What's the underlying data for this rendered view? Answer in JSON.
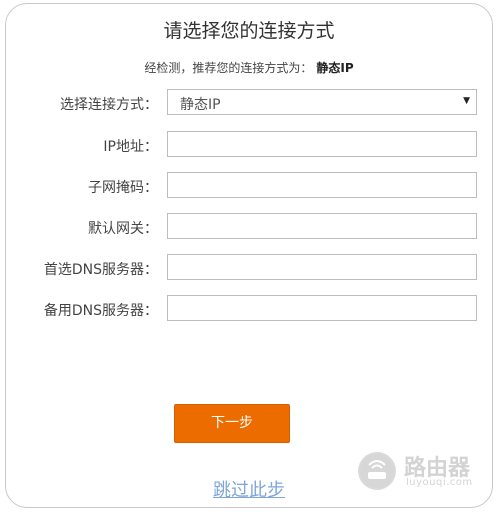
{
  "dialog": {
    "title": "请选择您的连接方式",
    "detect_prefix": "经检测，推荐您的连接方式为：",
    "detect_value": "静态IP"
  },
  "form": {
    "connection_type": {
      "label": "选择连接方式：",
      "selected": "静态IP"
    },
    "ip_address": {
      "label": "IP地址：",
      "value": ""
    },
    "subnet_mask": {
      "label": "子网掩码：",
      "value": ""
    },
    "default_gateway": {
      "label": "默认网关：",
      "value": ""
    },
    "primary_dns": {
      "label": "首选DNS服务器：",
      "value": ""
    },
    "secondary_dns": {
      "label": "备用DNS服务器：",
      "value": ""
    }
  },
  "actions": {
    "next_label": "下一步",
    "skip_label": "跳过此步"
  },
  "watermark": {
    "text": "路由器",
    "url": "luyouqi.com"
  },
  "colors": {
    "accent": "#ec6c00",
    "link": "#7fa6d8",
    "border": "#c9c9c9"
  },
  "icons": {
    "dropdown": "chevron-down-icon"
  }
}
